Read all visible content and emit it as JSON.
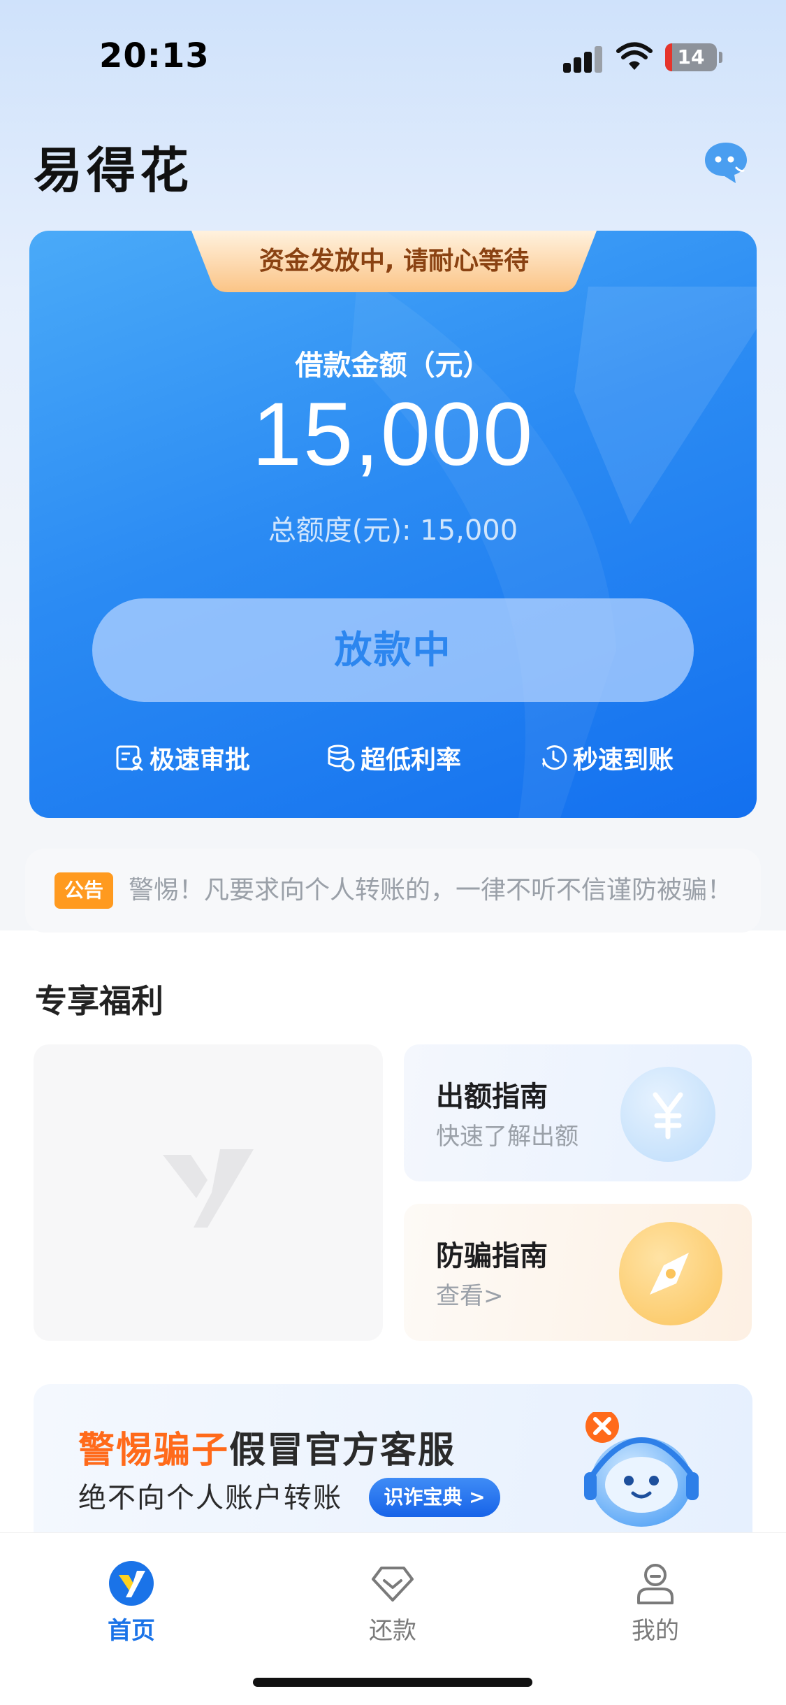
{
  "status_bar": {
    "time": "20:13",
    "battery_level": "14",
    "icons": [
      "cellular-signal-icon",
      "wifi-icon",
      "battery-icon"
    ]
  },
  "header": {
    "title": "易得花",
    "chat_icon": "customer-service-chat-icon"
  },
  "loan_card": {
    "status_banner": "资金发放中, 请耐心等待",
    "amount_label": "借款金额（元）",
    "amount_value": "15,000",
    "total_limit": "总额度(元): 15,000",
    "button_label": "放款中",
    "features": [
      {
        "label": "极速审批",
        "icon": "approval-icon"
      },
      {
        "label": "超低利率",
        "icon": "coins-icon"
      },
      {
        "label": "秒速到账",
        "icon": "clock-icon"
      }
    ]
  },
  "notice": {
    "badge": "公告",
    "text": "警惕！凡要求向个人转账的，一律不听不信谨防被骗！"
  },
  "benefits": {
    "title": "专享福利",
    "guides": [
      {
        "title": "出额指南",
        "subtitle": "快速了解出额",
        "icon": "yuan-icon"
      },
      {
        "title": "防骗指南",
        "subtitle": "查看>",
        "icon": "compass-icon"
      }
    ]
  },
  "scam_banner": {
    "highlight": "警惕骗子",
    "rest": "假冒官方客服",
    "line2": "绝不向个人账户转账",
    "button": "识诈宝典 >"
  },
  "tabs": [
    {
      "label": "首页",
      "icon": "home-logo-icon",
      "active": true
    },
    {
      "label": "还款",
      "icon": "repay-diamond-icon",
      "active": false
    },
    {
      "label": "我的",
      "icon": "profile-icon",
      "active": false
    }
  ],
  "colors": {
    "primary": "#1a73e8",
    "card_blue": "#2b8bf3",
    "accent_orange": "#ff6a1a",
    "notice_orange": "#ff9a1f"
  }
}
